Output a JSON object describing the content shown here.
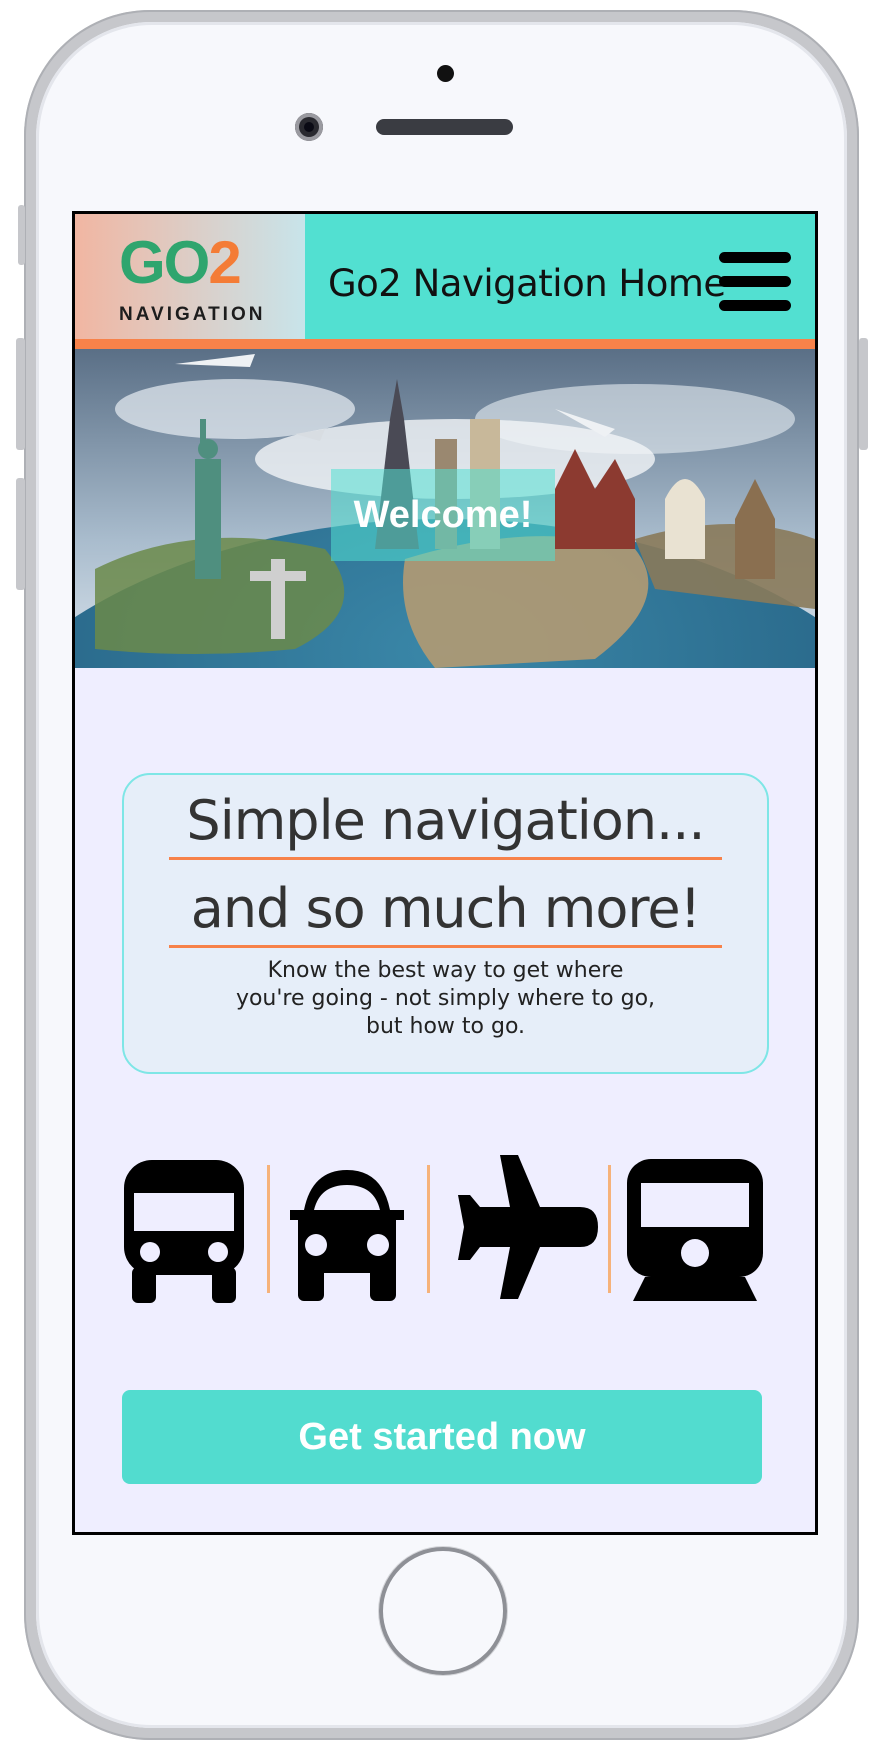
{
  "header": {
    "logo_main": "GO",
    "logo_accent": "2",
    "logo_sub": "NAVIGATION",
    "title": "Go2 Navigation Home",
    "menu_icon": "hamburger-menu-icon"
  },
  "hero": {
    "welcome": "Welcome!",
    "image": "world-landmarks-globe-with-airplanes"
  },
  "intro": {
    "headline_1": "Simple navigation...",
    "headline_2": "and so much more!",
    "tagline_1": "Know the best way to get where",
    "tagline_2": "you're going - not simply where to go,",
    "tagline_3": "but how to go."
  },
  "transport": {
    "icons": [
      "bus-icon",
      "car-icon",
      "airplane-icon",
      "train-icon"
    ]
  },
  "cta": {
    "label": "Get started now"
  },
  "colors": {
    "header_bg": "#52e0d1",
    "accent_orange": "#f7824a",
    "logo_green": "#2fa56e",
    "logo_orange": "#f47c36",
    "page_bg": "#efeeff",
    "card_border": "#7ee6e6",
    "card_bg": "#e6eef9",
    "cta_bg": "#52dccf"
  }
}
